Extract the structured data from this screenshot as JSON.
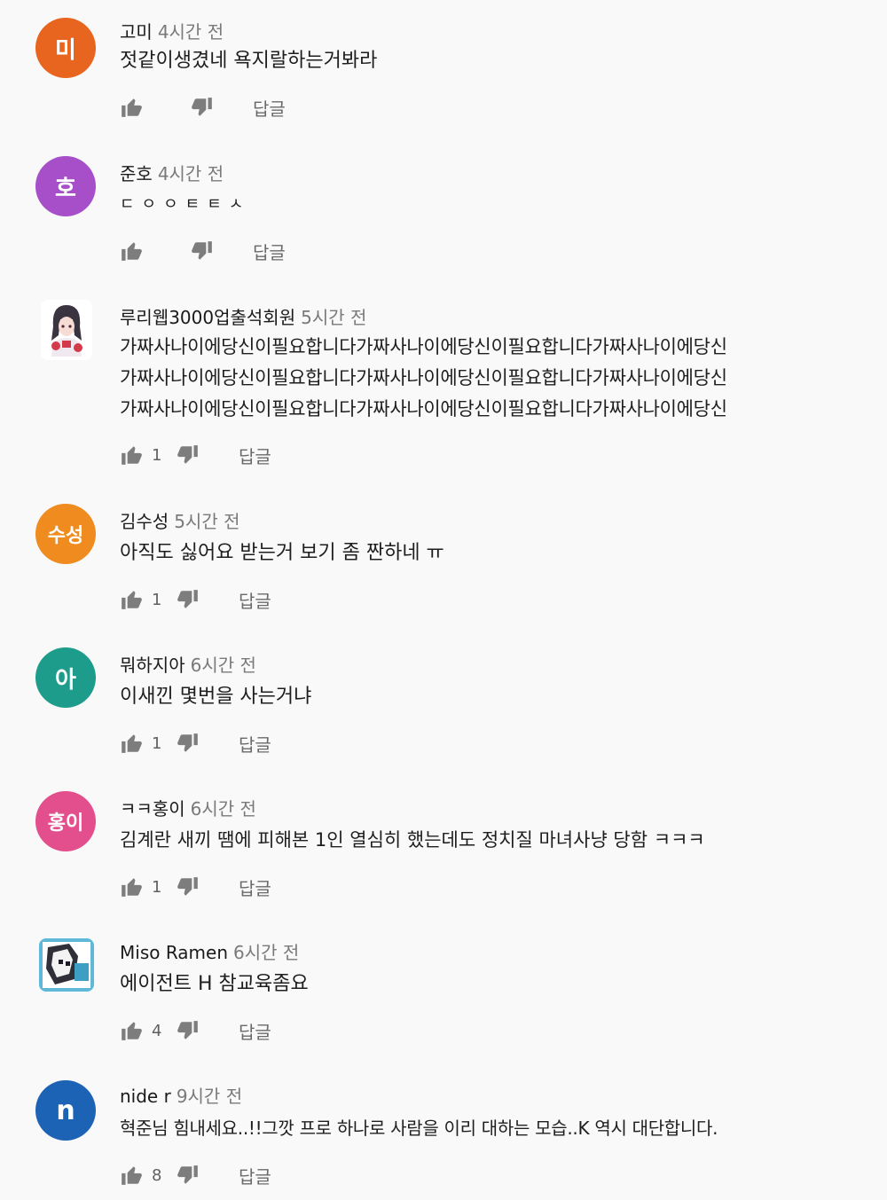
{
  "reply_label": "답글",
  "comments": [
    {
      "author": "고미",
      "time": "4시간 전",
      "text": "젓같이생겼네 욕지랄하는거봐라",
      "likes": "",
      "avatar_text": "미",
      "avatar_color": "#e8651f"
    },
    {
      "author": "준호",
      "time": "4시간 전",
      "text": "ㄷㅇㅇㅌㅌㅅ",
      "likes": "",
      "avatar_text": "호",
      "avatar_color": "#a64fc9"
    },
    {
      "author": "루리웹3000업출석회원",
      "time": "5시간 전",
      "text": "가짜사나이에당신이필요합니다가짜사나이에당신이필요합니다가짜사나이에당신\n가짜사나이에당신이필요합니다가짜사나이에당신이필요합니다가짜사나이에당신\n가짜사나이에당신이필요합니다가짜사나이에당신이필요합니다가짜사나이에당신",
      "likes": "1",
      "avatar_text": "",
      "avatar_color": "#ffffff"
    },
    {
      "author": "김수성",
      "time": "5시간 전",
      "text": "아직도 싫어요 받는거 보기 좀 짠하네 ㅠ",
      "likes": "1",
      "avatar_text": "수성",
      "avatar_color": "#ef8b1f"
    },
    {
      "author": "뭐하지아",
      "time": "6시간 전",
      "text": "이새낀 몇번을 사는거냐",
      "likes": "1",
      "avatar_text": "아",
      "avatar_color": "#1e9c8b"
    },
    {
      "author": "ㅋㅋ홍이",
      "time": "6시간 전",
      "text": "김계란 새끼 땜에 피해본 1인 열심히 했는데도 정치질 마녀사냥 당함 ㅋㅋㅋ",
      "likes": "1",
      "avatar_text": "홍이",
      "avatar_color": "#e34f8c"
    },
    {
      "author": "Miso Ramen",
      "time": "6시간 전",
      "text": "에이전트 H 참교육좀요",
      "likes": "4",
      "avatar_text": "",
      "avatar_color": "#ffffff"
    },
    {
      "author": "nide r",
      "time": "9시간 전",
      "text": "혁준님 힘내세요..!!그깟 프로 하나로 사람을 이리 대하는 모습..K 역시 대단합니다.",
      "likes": "8",
      "avatar_text": "n",
      "avatar_color": "#1d63b5"
    }
  ]
}
